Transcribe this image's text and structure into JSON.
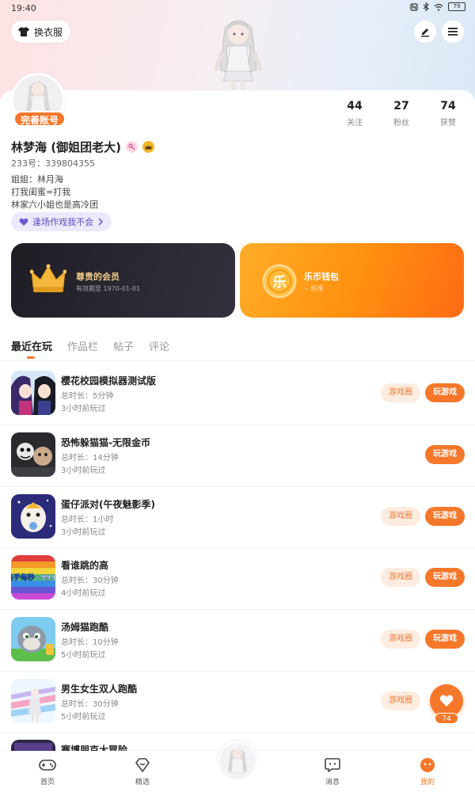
{
  "status_bar": {
    "time": "19:40",
    "battery": "79"
  },
  "header": {
    "outfit_label": "换衣服"
  },
  "profile": {
    "complete_badge": "完善账号",
    "stats": [
      {
        "num": "44",
        "label": "关注"
      },
      {
        "num": "27",
        "label": "粉丝"
      },
      {
        "num": "74",
        "label": "获赞"
      }
    ],
    "name": "林梦海 (御姐团老大)",
    "uid": "233号：339804355",
    "bio": [
      "姐姐：林月海",
      "打我闺蜜=打我",
      "林家六小姐也是高冷团"
    ],
    "pill": "逢场作戏我不会"
  },
  "cards": {
    "vip": {
      "title": "尊贵的会员",
      "subtitle": "有效期至 1970-01-01"
    },
    "wallet": {
      "title": "乐币钱包",
      "subtitle": "-- 乐币",
      "coin_char": "乐"
    }
  },
  "tabs": [
    "最近在玩",
    "作品栏",
    "帖子",
    "评论"
  ],
  "games": [
    {
      "name": "樱花校园模拟器测试版",
      "duration": "总时长：5分钟",
      "ago": "3小时前玩过",
      "circle": "游戏圈",
      "play": "玩游戏"
    },
    {
      "name": "恐怖躲猫猫-无限金币",
      "duration": "总时长：14分钟",
      "ago": "3小时前玩过",
      "circle": "",
      "play": "玩游戏"
    },
    {
      "name": "蛋仔派对(午夜魅影季)",
      "duration": "总时长：1小时",
      "ago": "3小时前玩过",
      "circle": "游戏圈",
      "play": "玩游戏"
    },
    {
      "name": "看谁跳的高",
      "duration": "总时长：30分钟",
      "ago": "4小时前玩过",
      "circle": "游戏圈",
      "play": "玩游戏"
    },
    {
      "name": "汤姆猫跑酷",
      "duration": "总时长：10分钟",
      "ago": "5小时前玩过",
      "circle": "游戏圈",
      "play": "玩游戏"
    },
    {
      "name": "男生女生双人跑酷",
      "duration": "总时长：30分钟",
      "ago": "5小时前玩过",
      "circle": "游戏圈",
      "play": ""
    },
    {
      "name": "赛博朋克大冒险",
      "duration": "",
      "ago": "",
      "circle": "",
      "play": ""
    }
  ],
  "game4_thumb_text": "高手每秒+9999",
  "like": {
    "count": "74"
  },
  "nav": {
    "home": "首页",
    "featured": "精选",
    "messages": "消息",
    "mine": "我的"
  },
  "colors": {
    "accent": "#f5772a",
    "vip_gold": "#f1c98a",
    "pill_purple": "#5a4bc8"
  }
}
